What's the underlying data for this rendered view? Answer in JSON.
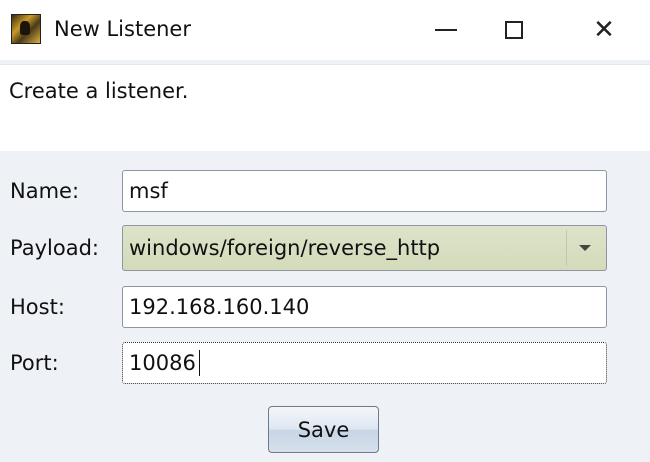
{
  "window": {
    "title": "New Listener",
    "app_icon": "armitage-app-icon",
    "controls": {
      "minimize_icon": "minimize-icon",
      "maximize_icon": "maximize-icon",
      "close_icon": "close-icon",
      "close_glyph": "✕"
    }
  },
  "description": "Create a listener.",
  "form": {
    "name": {
      "label": "Name:",
      "value": "msf"
    },
    "payload": {
      "label": "Payload:",
      "value": "windows/foreign/reverse_http"
    },
    "host": {
      "label": "Host:",
      "value": "192.168.160.140"
    },
    "port": {
      "label": "Port:",
      "value": "10086"
    }
  },
  "buttons": {
    "save_label": "Save"
  },
  "colors": {
    "background": "#eef1f6",
    "select_background": "#d8dfc1",
    "button_accent": "#c8d5e6"
  }
}
